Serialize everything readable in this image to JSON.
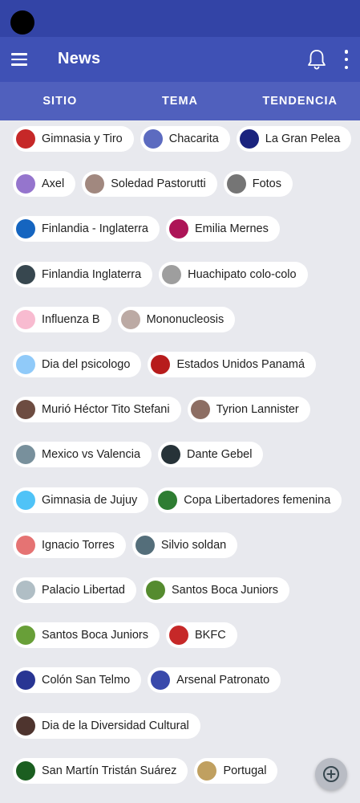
{
  "app_bar": {
    "title": "News"
  },
  "tabs": [
    "SITIO",
    "TEMA",
    "TENDENCIA"
  ],
  "chip_rows": [
    [
      {
        "label": "Gimnasia y Tiro",
        "avatar": "#c62828"
      },
      {
        "label": "Chacarita",
        "avatar": "#5c6bc0"
      },
      {
        "label": "La Gran Pelea",
        "avatar": "#1a237e"
      }
    ],
    [
      {
        "label": "Axel",
        "avatar": "#9575cd"
      },
      {
        "label": "Soledad Pastorutti",
        "avatar": "#a1887f"
      },
      {
        "label": "Fotos",
        "avatar": "#757575"
      }
    ],
    [
      {
        "label": "Finlandia - Inglaterra",
        "avatar": "#1565c0"
      },
      {
        "label": "Emilia Mernes",
        "avatar": "#ad1457"
      }
    ],
    [
      {
        "label": "Finlandia  Inglaterra",
        "avatar": "#37474f"
      },
      {
        "label": "Huachipato  colo-colo",
        "avatar": "#9e9e9e"
      }
    ],
    [
      {
        "label": "Influenza B",
        "avatar": "#f8bbd0"
      },
      {
        "label": "Mononucleosis",
        "avatar": "#bcaaa4"
      }
    ],
    [
      {
        "label": "Dia del psicologo",
        "avatar": "#90caf9"
      },
      {
        "label": "Estados Unidos  Panamá",
        "avatar": "#b71c1c"
      }
    ],
    [
      {
        "label": "Murió Héctor Tito Stefani",
        "avatar": "#6d4c41"
      },
      {
        "label": "Tyrion Lannister",
        "avatar": "#8d6e63"
      }
    ],
    [
      {
        "label": "Mexico vs Valencia",
        "avatar": "#78909c"
      },
      {
        "label": "Dante Gebel",
        "avatar": "#263238"
      }
    ],
    [
      {
        "label": "Gimnasia de Jujuy",
        "avatar": "#4fc3f7"
      },
      {
        "label": "Copa Libertadores femenina",
        "avatar": "#2e7d32"
      }
    ],
    [
      {
        "label": "Ignacio Torres",
        "avatar": "#e57373"
      },
      {
        "label": "Silvio soldan",
        "avatar": "#546e7a"
      }
    ],
    [
      {
        "label": "Palacio Libertad",
        "avatar": "#b0bec5"
      },
      {
        "label": "Santos  Boca Juniors",
        "avatar": "#558b2f"
      }
    ],
    [
      {
        "label": "Santos Boca Juniors",
        "avatar": "#689f38"
      },
      {
        "label": "BKFC",
        "avatar": "#c62828"
      }
    ],
    [
      {
        "label": "Colón  San Telmo",
        "avatar": "#283593"
      },
      {
        "label": "Arsenal  Patronato",
        "avatar": "#3949ab"
      }
    ],
    [
      {
        "label": "Dia de la Diversidad Cultural",
        "avatar": "#4e342e"
      }
    ],
    [
      {
        "label": "San Martín  Tristán Suárez",
        "avatar": "#1b5e20"
      },
      {
        "label": "Portugal",
        "avatar": "#c0a060"
      }
    ]
  ],
  "colors": {
    "status_bar": "#3344a6",
    "app_bar": "#3f51b5",
    "tab_bar": "#5060bd",
    "background": "#e8e9ee",
    "chip": "#ffffff",
    "fab": "#b9bcc4"
  },
  "icons": {
    "menu": "menu-icon",
    "notifications": "bell-icon",
    "overflow": "more-vert-icon",
    "fab": "add-circle-icon"
  }
}
